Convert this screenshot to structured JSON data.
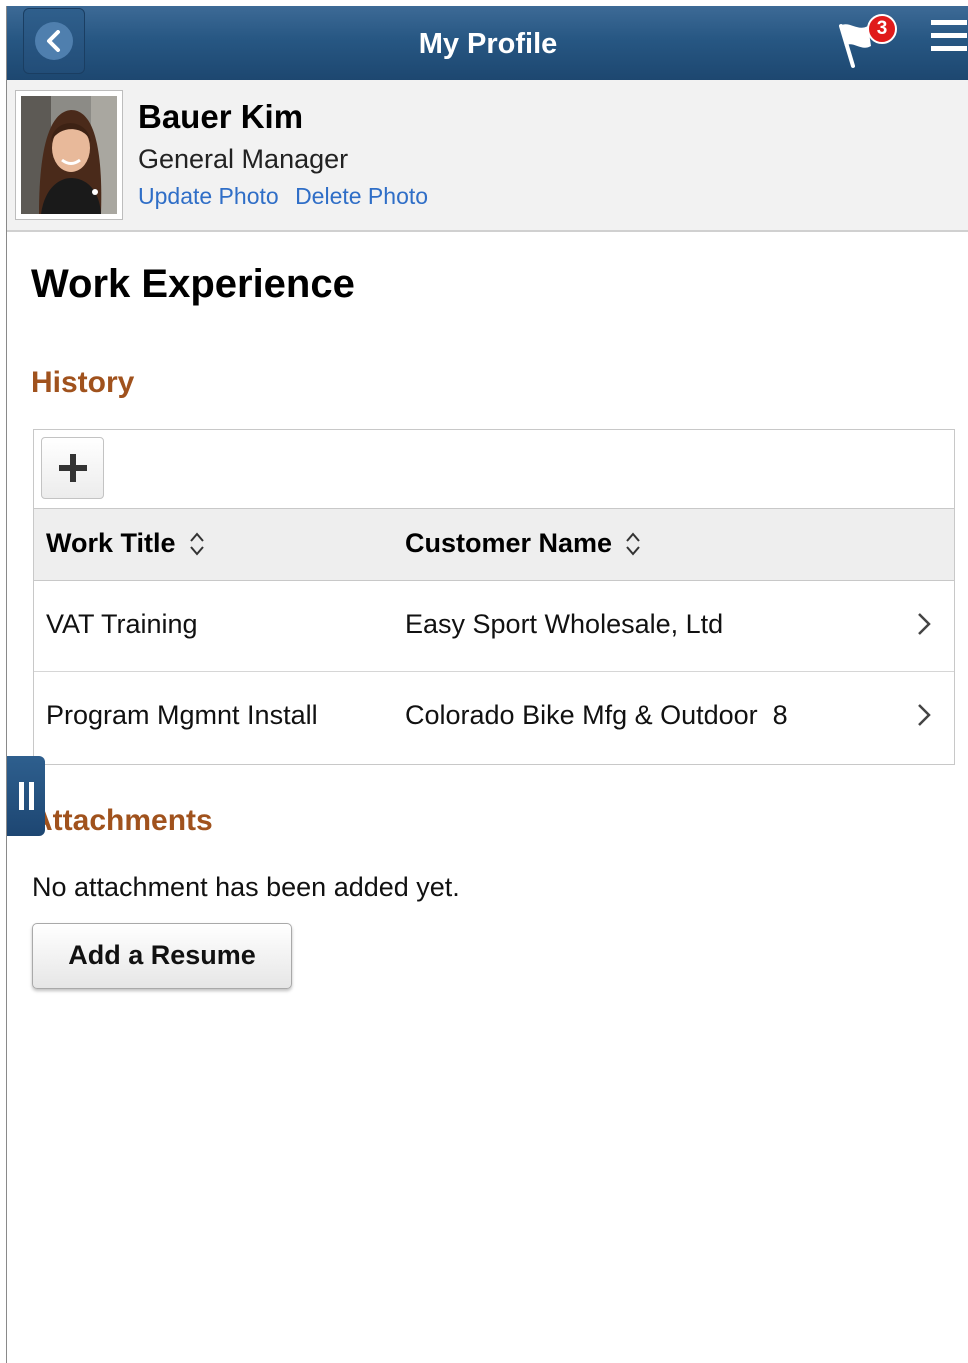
{
  "header": {
    "title": "My Profile",
    "notification_count": "3",
    "back_icon": "chevron-left-icon",
    "flag_icon": "flag-icon",
    "menu_icon": "hamburger-icon"
  },
  "profile": {
    "name": "Bauer Kim",
    "job_title": "General Manager",
    "update_photo": "Update Photo",
    "delete_photo": "Delete Photo"
  },
  "page": {
    "title": "Work Experience"
  },
  "history": {
    "heading": "History",
    "columns": [
      "Work Title",
      "Customer Name"
    ],
    "rows": [
      {
        "work_title": "VAT Training",
        "customer_name": "Easy Sport Wholesale, Ltd"
      },
      {
        "work_title": "Program Mgmnt Install",
        "customer_name": "Colorado Bike Mfg & Outdoor  8"
      }
    ]
  },
  "attachments": {
    "heading": "Attachments",
    "empty_text": "No attachment has been added yet.",
    "add_button": "Add a Resume"
  },
  "colors": {
    "header_bg": "#275783",
    "section_heading": "#a0521d",
    "link": "#2f6ec7",
    "badge": "#e01b1b"
  }
}
